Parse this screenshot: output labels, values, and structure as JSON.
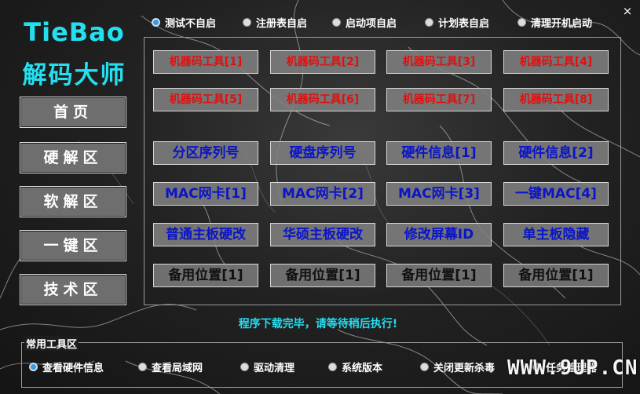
{
  "app": {
    "title_line1": "TieBao",
    "title_line2": "解码大师",
    "close_glyph": "×"
  },
  "colors": {
    "brand_cyan": "#22e0f0",
    "red_label": "#e01010",
    "blue_label": "#0a14c8",
    "status_text": "#24dcef",
    "radio_selected": "#3b9be0"
  },
  "top_radios": [
    {
      "label": "测试不自启",
      "selected": true
    },
    {
      "label": "注册表自启",
      "selected": false
    },
    {
      "label": "启动项自启",
      "selected": false
    },
    {
      "label": "计划表自启",
      "selected": false
    },
    {
      "label": "清理开机启动",
      "selected": false
    }
  ],
  "nav": [
    {
      "label": "首页"
    },
    {
      "label": "硬解区"
    },
    {
      "label": "软解区"
    },
    {
      "label": "一键区"
    },
    {
      "label": "技术区"
    }
  ],
  "tools": {
    "row1": [
      "机器码工具[1]",
      "机器码工具[2]",
      "机器码工具[3]",
      "机器码工具[4]"
    ],
    "row2": [
      "机器码工具[5]",
      "机器码工具[6]",
      "机器码工具[7]",
      "机器码工具[8]"
    ],
    "row3": [
      "分区序列号",
      "硬盘序列号",
      "硬件信息[1]",
      "硬件信息[2]"
    ],
    "row4": [
      "MAC网卡[1]",
      "MAC网卡[2]",
      "MAC网卡[3]",
      "一键MAC[4]"
    ],
    "row5": [
      "普通主板硬改",
      "华硕主板硬改",
      "修改屏幕ID",
      "单主板隐藏"
    ],
    "row6": [
      "备用位置[1]",
      "备用位置[1]",
      "备用位置[1]",
      "备用位置[1]"
    ]
  },
  "status": "程序下载完毕，请等待稍后执行!",
  "common_tools": {
    "title": "常用工具区",
    "items": [
      {
        "label": "查看硬件信息",
        "selected": true
      },
      {
        "label": "查看局域网",
        "selected": false
      },
      {
        "label": "驱动清理",
        "selected": false
      },
      {
        "label": "系统版本",
        "selected": false
      },
      {
        "label": "关闭更新杀毒",
        "selected": false
      },
      {
        "label": "任务管理器",
        "selected": false
      }
    ]
  },
  "watermark": "WWW.9UP.CN"
}
